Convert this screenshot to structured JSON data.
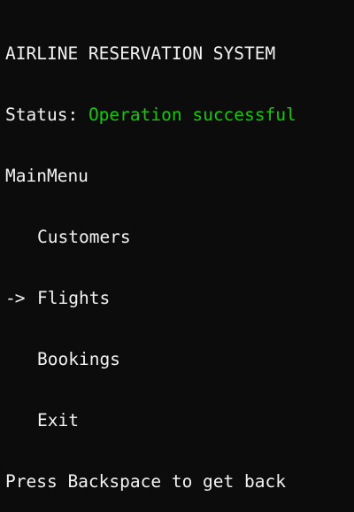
{
  "app": {
    "title": "AIRLINE RESERVATION SYSTEM"
  },
  "status": {
    "label": "Status:",
    "value": "Operation successful",
    "value_color": "#16c60c"
  },
  "menu": {
    "title": "MainMenu",
    "cursor": "->",
    "selected_index": 1,
    "items": [
      {
        "label": "Customers",
        "cursor": ""
      },
      {
        "label": "Flights",
        "cursor": "->"
      },
      {
        "label": "Bookings",
        "cursor": ""
      },
      {
        "label": "Exit",
        "cursor": ""
      }
    ]
  },
  "hint": {
    "text": "Press Backspace to get back"
  },
  "colors": {
    "background": "#0c0c0c",
    "text": "#f2f2f2",
    "success": "#16c60c"
  }
}
